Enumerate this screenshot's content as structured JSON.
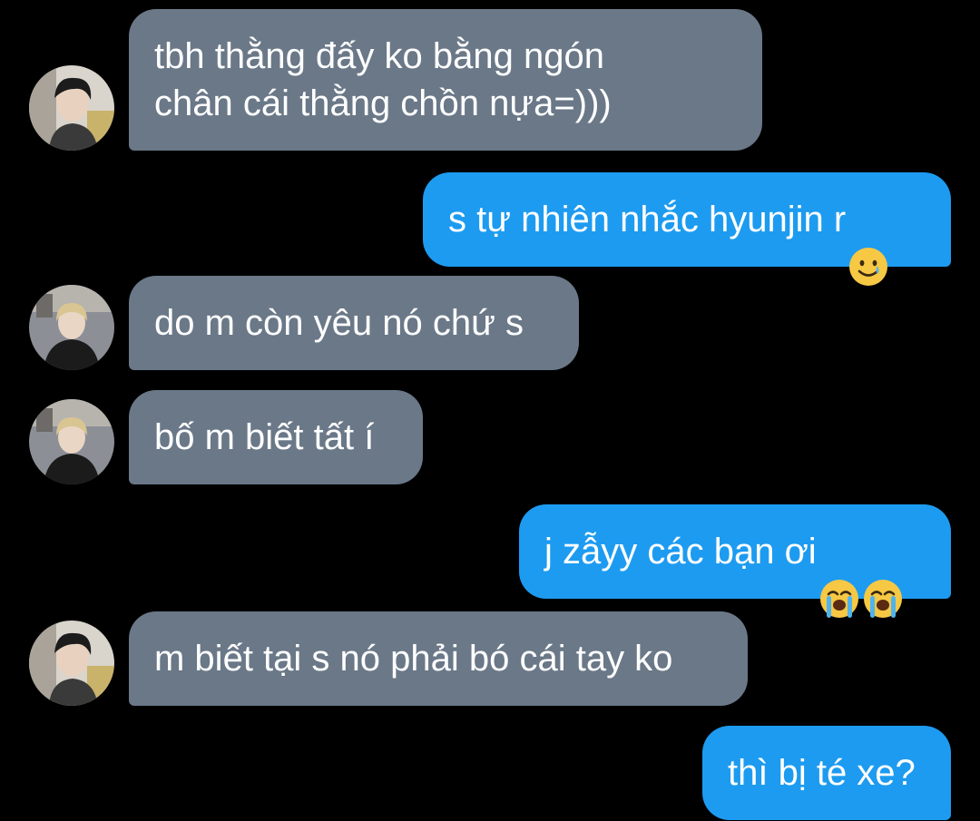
{
  "messages": [
    {
      "sender": "them",
      "text": "tbh thằng đấy ko bằng ngón\nchân cái thằng chồn nựa=)))",
      "avatar_icon": "avatar-icon"
    },
    {
      "sender": "me",
      "text": "s tự nhiên nhắc hyunjin r",
      "emoji": [
        "smiling-face-with-tear-icon"
      ]
    },
    {
      "sender": "them",
      "text": "do m còn yêu nó chứ s",
      "avatar_icon": "avatar-icon"
    },
    {
      "sender": "them",
      "text": "bố m biết tất í",
      "avatar_icon": "avatar-icon"
    },
    {
      "sender": "me",
      "text": "j zẫyy các bạn ơi",
      "emoji": [
        "loudly-crying-face-icon",
        "loudly-crying-face-icon"
      ]
    },
    {
      "sender": "them",
      "text": "m biết tại s nó phải bó cái tay ko",
      "avatar_icon": "avatar-icon"
    },
    {
      "sender": "me",
      "text": "thì bị té xe?"
    }
  ],
  "colors": {
    "background": "#000000",
    "incoming_bubble": "#6a7888",
    "outgoing_bubble": "#1d9bf0",
    "text": "#ffffff"
  }
}
